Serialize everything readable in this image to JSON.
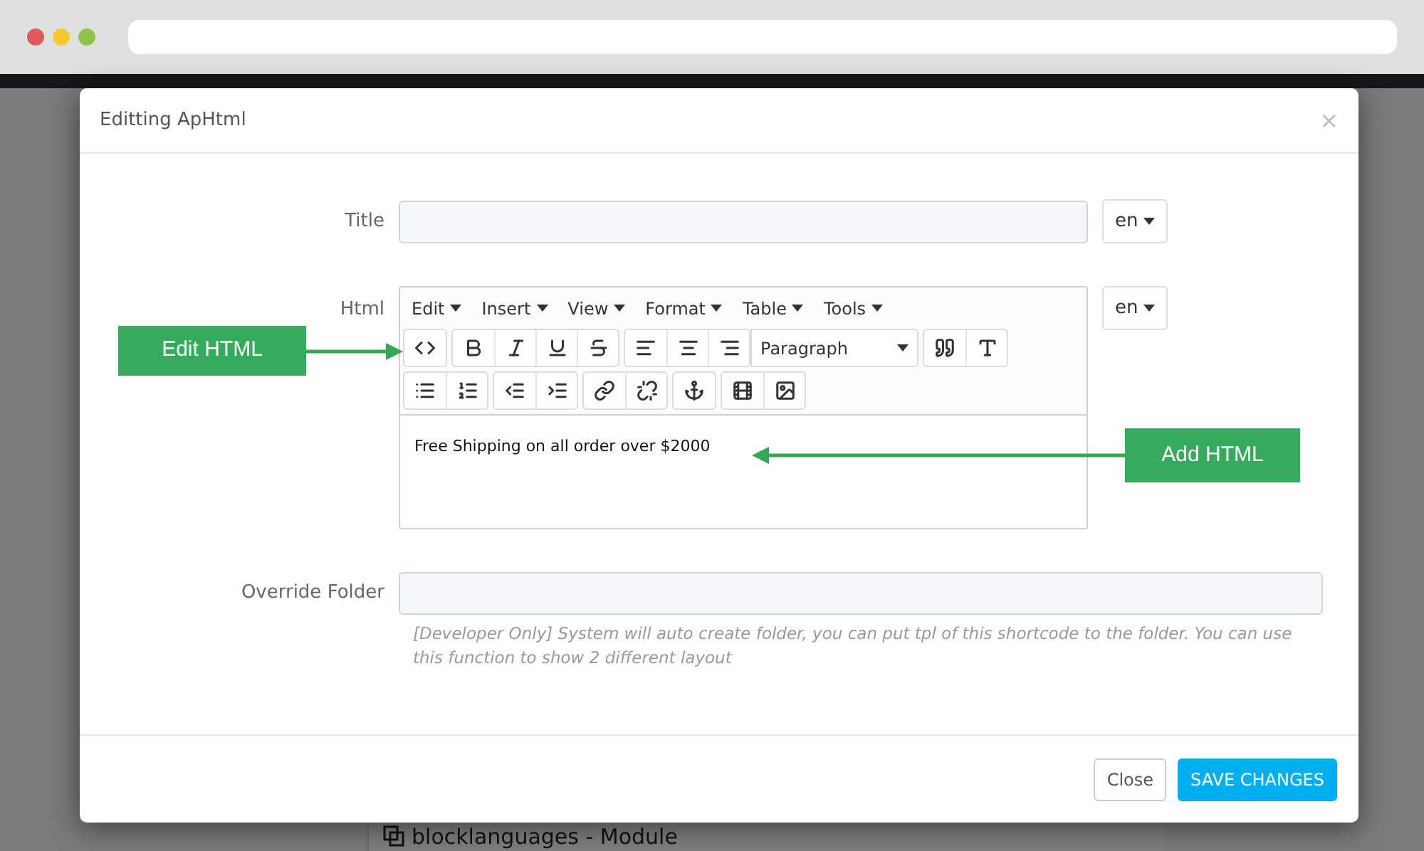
{
  "background": {
    "module_label": "blocklanguages - Module"
  },
  "dialog": {
    "title": "Editting ApHtml",
    "close": "×"
  },
  "form": {
    "title_field": {
      "label": "Title",
      "language": "en"
    },
    "html_field": {
      "label": "Html",
      "language": "en",
      "menus": [
        "Edit",
        "Insert",
        "View",
        "Format",
        "Table",
        "Tools"
      ],
      "block_format": "Paragraph",
      "content": "Free Shipping on all order over $2000"
    },
    "override_field": {
      "label": "Override Folder",
      "help": "[Developer Only] System will auto create folder, you can put tpl of this shortcode to the folder. You can use this function to show 2 different layout"
    }
  },
  "annotations": [
    {
      "text": "Edit HTML",
      "kind": "rightward"
    },
    {
      "text": "Add HTML",
      "kind": "leftward"
    }
  ],
  "footer": {
    "buttons": [
      {
        "label": "Close",
        "kind": "secondary"
      },
      {
        "label": "SAVE CHANGES",
        "kind": "primary"
      }
    ]
  }
}
